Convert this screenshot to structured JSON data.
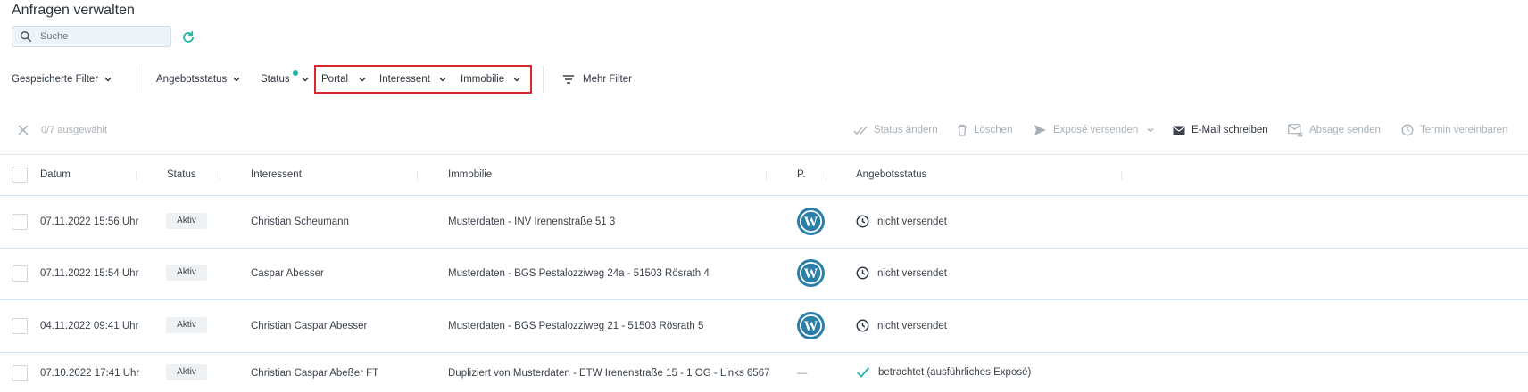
{
  "page": {
    "title": "Anfragen verwalten"
  },
  "search": {
    "placeholder": "Suche"
  },
  "filters": {
    "saved": "Gespeicherte Filter",
    "angebotsstatus": "Angebotsstatus",
    "status": "Status",
    "portal": "Portal",
    "interessent": "Interessent",
    "immobilie": "Immobilie",
    "more": "Mehr Filter"
  },
  "selection": {
    "count": "0/7 ausgewählt"
  },
  "actions": {
    "status_change": "Status ändern",
    "delete": "Löschen",
    "expose_send": "Exposé versenden",
    "email": "E-Mail schreiben",
    "decline": "Absage senden",
    "appointment": "Termin vereinbaren"
  },
  "table": {
    "headers": {
      "datum": "Datum",
      "status": "Status",
      "interessent": "Interessent",
      "immobilie": "Immobilie",
      "portal": "P.",
      "angebotsstatus": "Angebotsstatus"
    },
    "rows": [
      {
        "datum": "07.11.2022 15:56 Uhr",
        "status": "Aktiv",
        "interessent": "Christian Scheumann",
        "immobilie": "Musterdaten - INV Irenenstraße 51 3",
        "portal": "wordpress-icon",
        "angebotsstatus": "nicht versendet"
      },
      {
        "datum": "07.11.2022 15:54 Uhr",
        "status": "Aktiv",
        "interessent": "Caspar Abesser",
        "immobilie": "Musterdaten - BGS Pestalozziweg 24a - 51503 Rösrath 4",
        "portal": "wordpress-icon",
        "angebotsstatus": "nicht versendet"
      },
      {
        "datum": "04.11.2022 09:41 Uhr",
        "status": "Aktiv",
        "interessent": "Christian Caspar Abesser",
        "immobilie": "Musterdaten - BGS Pestalozziweg 21 - 51503 Rösrath 5",
        "portal": "wordpress-icon",
        "angebotsstatus": "nicht versendet"
      },
      {
        "datum": "07.10.2022 17:41 Uhr",
        "status": "Aktiv",
        "interessent": "Christian Caspar Abeßer FT",
        "immobilie": "Dupliziert von Musterdaten - ETW Irenenstraße 15 - 1 OG - Links 6567",
        "portal": "—",
        "angebotsstatus": "betrachtet (ausführliches Exposé)"
      }
    ]
  },
  "colors": {
    "accent": "#1fb7a6",
    "highlight": "#d9252b",
    "wordpress": "#2a7ea8"
  }
}
